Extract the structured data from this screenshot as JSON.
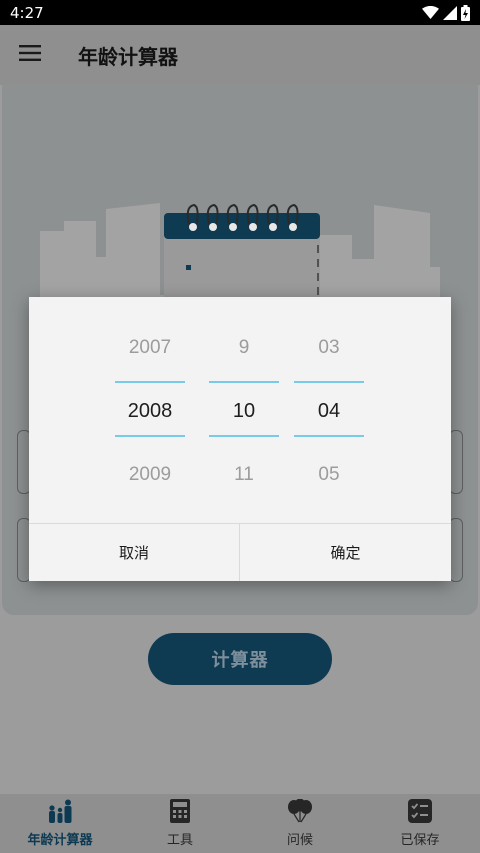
{
  "status_bar": {
    "time": "4:27",
    "icons": [
      "wifi-icon",
      "signal-icon",
      "battery-charging-icon"
    ]
  },
  "app_bar": {
    "menu_icon": "menu-icon",
    "title": "年龄计算器"
  },
  "main": {
    "calculate_button": "计算器"
  },
  "date_picker": {
    "year": {
      "prev": "2007",
      "selected": "2008",
      "next": "2009"
    },
    "month": {
      "prev": "9",
      "selected": "10",
      "next": "11"
    },
    "day": {
      "prev": "03",
      "selected": "04",
      "next": "05"
    },
    "cancel_label": "取消",
    "confirm_label": "确定",
    "accent_color": "#78cbe8"
  },
  "bottom_nav": {
    "items": [
      {
        "label": "年龄计算器",
        "icon": "family-icon",
        "active": true
      },
      {
        "label": "工具",
        "icon": "calculator-icon",
        "active": false
      },
      {
        "label": "问候",
        "icon": "balloons-icon",
        "active": false
      },
      {
        "label": "已保存",
        "icon": "checklist-icon",
        "active": false
      }
    ],
    "active_color": "#0d3a53"
  }
}
